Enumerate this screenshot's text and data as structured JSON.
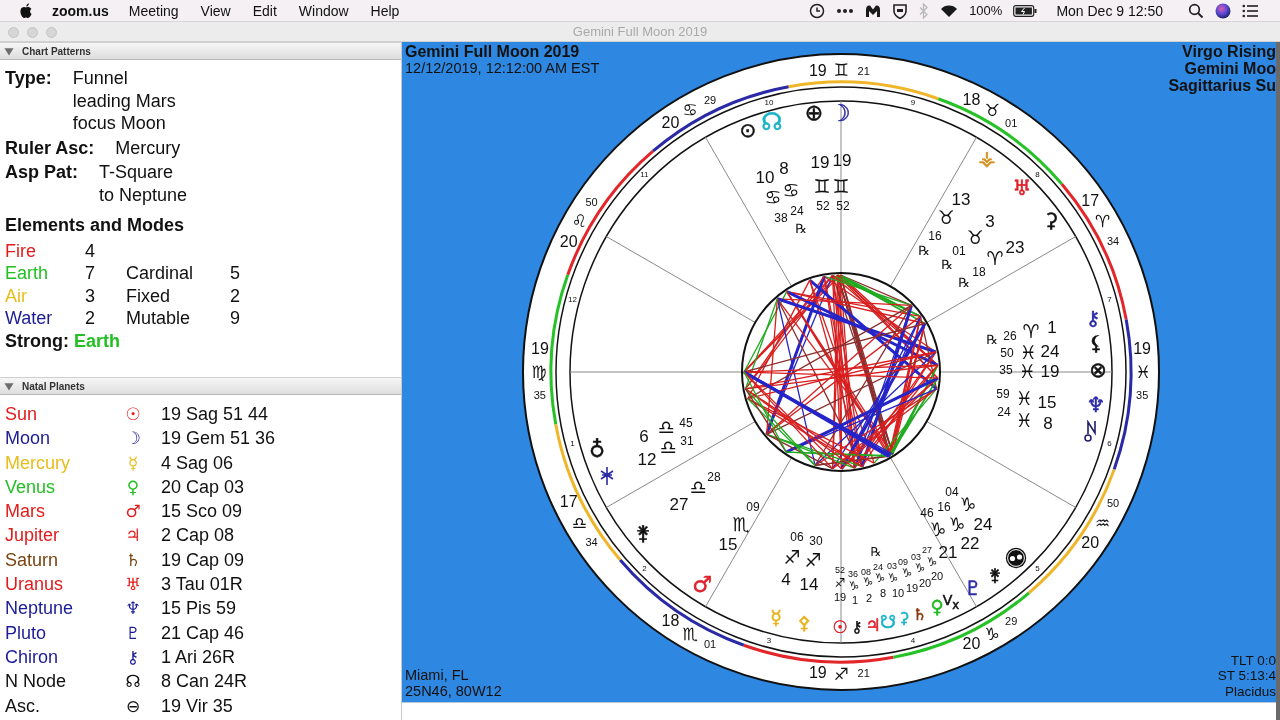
{
  "menubar": {
    "app": "zoom.us",
    "menus": [
      "Meeting",
      "View",
      "Edit",
      "Window",
      "Help"
    ],
    "battery": "100%",
    "clock": "Mon Dec 9 12:50"
  },
  "window": {
    "title": "Gemini Full Moon 2019"
  },
  "chart_patterns": {
    "title": "Chart Patterns",
    "expanded": true,
    "fields": [
      {
        "label": "Type:",
        "values": [
          "Funnel",
          "leading Mars",
          "focus Moon"
        ]
      },
      {
        "label": "Ruler Asc:",
        "values": [
          "Mercury"
        ]
      },
      {
        "label": "Asp Pat:",
        "values": [
          "T-Square",
          "to Neptune"
        ]
      }
    ],
    "elements_title": "Elements and Modes",
    "elements": [
      {
        "name": "Fire",
        "count": "4",
        "color": "#e21b1b"
      },
      {
        "name": "Earth",
        "count": "7",
        "color": "#23c023"
      },
      {
        "name": "Air",
        "count": "3",
        "color": "#e8bd1a"
      },
      {
        "name": "Water",
        "count": "2",
        "color": "#1c1c96"
      }
    ],
    "modes": [
      {
        "name": "Cardinal",
        "count": "5"
      },
      {
        "name": "Fixed",
        "count": "2"
      },
      {
        "name": "Mutable",
        "count": "9"
      }
    ],
    "strong": {
      "label": "Strong:",
      "value": "Earth",
      "color": "#23c023"
    }
  },
  "natal_planets": {
    "title": "Natal Planets",
    "expanded": true,
    "rows": [
      {
        "name": "Sun",
        "glyph": "☉",
        "position": "19 Sag 51 44",
        "color": "#e21b1b"
      },
      {
        "name": "Moon",
        "glyph": "☽",
        "position": "19 Gem 51 36",
        "color": "#1c1c96"
      },
      {
        "name": "Mercury",
        "glyph": "☿",
        "position": "4 Sag 06",
        "color": "#e8bd1a"
      },
      {
        "name": "Venus",
        "glyph": "♀",
        "position": "20 Cap 03",
        "color": "#23c023"
      },
      {
        "name": "Mars",
        "glyph": "♂",
        "position": "15 Sco 09",
        "color": "#e21b1b"
      },
      {
        "name": "Jupiter",
        "glyph": "♃",
        "position": "2 Cap 08",
        "color": "#e21b1b"
      },
      {
        "name": "Saturn",
        "glyph": "♄",
        "position": "19 Cap 09",
        "color": "#7a4412"
      },
      {
        "name": "Uranus",
        "glyph": "♅",
        "position": "3 Tau 01R",
        "color": "#e21b1b"
      },
      {
        "name": "Neptune",
        "glyph": "♆",
        "position": "15 Pis 59",
        "color": "#1c1c96"
      },
      {
        "name": "Pluto",
        "glyph": "♇",
        "position": "21 Cap 46",
        "color": "#1c1c96"
      },
      {
        "name": "Chiron",
        "glyph": "⚷",
        "position": "1 Ari 26R",
        "color": "#1c1c96"
      },
      {
        "name": "N Node",
        "glyph": "☊",
        "position": "8 Can 24R",
        "color": "#111111"
      },
      {
        "name": "Asc.",
        "glyph": "⊖",
        "position": "19 Vir 35",
        "color": "#111111"
      }
    ]
  },
  "chart": {
    "title": "Gemini Full Moon 2019",
    "datetime": "12/12/2019, 12:12:00 AM EST",
    "summary": [
      "Virgo Rising",
      "Gemini Moo",
      "Sagittarius Su"
    ],
    "location": [
      "Miami, FL",
      "25N46, 80W12"
    ],
    "info": [
      "TLT 0:0",
      "ST 5:13:4",
      "Placidus"
    ],
    "cusps": [
      {
        "degree": "19",
        "sign": "♍",
        "minutes": "35"
      },
      {
        "degree": "17",
        "sign": "♎",
        "minutes": "34"
      },
      {
        "degree": "18",
        "sign": "♏",
        "minutes": "01"
      },
      {
        "degree": "19",
        "sign": "♐",
        "minutes": "21"
      },
      {
        "degree": "20",
        "sign": "♑",
        "minutes": "29"
      },
      {
        "degree": "20",
        "sign": "♒",
        "minutes": "50"
      },
      {
        "degree": "19",
        "sign": "♓",
        "minutes": "35"
      },
      {
        "degree": "17",
        "sign": "♈",
        "minutes": "34"
      },
      {
        "degree": "18",
        "sign": "♉",
        "minutes": "01"
      },
      {
        "degree": "19",
        "sign": "♊",
        "minutes": "21"
      },
      {
        "degree": "20",
        "sign": "♋",
        "minutes": "29"
      },
      {
        "degree": "20",
        "sign": "♌",
        "minutes": "50"
      }
    ],
    "house_numbers": [
      "1",
      "2",
      "3",
      "4",
      "5",
      "6",
      "7",
      "8",
      "9",
      "10",
      "11",
      "12"
    ],
    "points": [
      {
        "glyph": "⊙",
        "color": "#111111"
      },
      {
        "glyph": "☊",
        "color": "#19b3c9"
      },
      {
        "glyph": "⊕",
        "color": "#111111"
      },
      {
        "glyph": "☽",
        "color": "#2b2ba6"
      },
      {
        "glyph": "⚶",
        "color": "#d4901e"
      },
      {
        "glyph": "♅",
        "color": "#e0202a"
      },
      {
        "glyph": "⚳",
        "color": "#111111"
      },
      {
        "glyph": "⚷",
        "color": "#2b2ba6"
      },
      {
        "glyph": "⚸",
        "color": "#111111"
      },
      {
        "glyph": "⊗",
        "color": "#111111"
      },
      {
        "glyph": "♆",
        "color": "#2b2ba6"
      },
      {
        "glyph": "♁",
        "color": "#111111"
      },
      {
        "glyph": "⚵",
        "color": "#111111"
      },
      {
        "glyph": "♂",
        "color": "#e0202a"
      },
      {
        "glyph": "☿",
        "color": "#e8b21e"
      },
      {
        "glyph": "⚴",
        "color": "#e8b21e"
      },
      {
        "glyph": "☉",
        "color": "#e0202a"
      },
      {
        "glyph": "⚷",
        "color": "#111111"
      },
      {
        "glyph": "♃",
        "color": "#e0202a"
      },
      {
        "glyph": "☋",
        "color": "#19b3c9"
      },
      {
        "glyph": "⚳",
        "color": "#19b3c9"
      },
      {
        "glyph": "♄",
        "color": "#8a3a14"
      },
      {
        "glyph": "♀",
        "color": "#22b822"
      },
      {
        "glyph": "V$_{x}$",
        "color": "#111111"
      },
      {
        "glyph": "♇",
        "color": "#2b2ba6"
      },
      {
        "glyph": "⚵",
        "color": "#111111"
      }
    ],
    "readings": [
      {
        "degree": "10",
        "sign": "♋",
        "minutes": "38"
      },
      {
        "degree": "8",
        "sign": "♋",
        "minutes": "24",
        "retrograde": "℞"
      },
      {
        "degree": "19",
        "sign": "♊",
        "minutes": "52"
      },
      {
        "degree": "19",
        "sign": "♊",
        "minutes": "52"
      },
      {
        "degree": "13",
        "sign": "♉",
        "minutes": "16",
        "retrograde": "℞"
      },
      {
        "degree": "3",
        "sign": "♉",
        "minutes": "01",
        "retrograde": "℞"
      },
      {
        "degree": "23",
        "sign": "♈",
        "minutes": "18",
        "retrograde": "℞"
      },
      {
        "degree": "1",
        "sign": "♈",
        "minutes": "26",
        "retrograde": "℞"
      },
      {
        "degree": "24",
        "sign": "♓",
        "minutes": "50"
      },
      {
        "degree": "19",
        "sign": "♓",
        "minutes": "35"
      },
      {
        "degree": "15",
        "sign": "♓",
        "minutes": "59"
      },
      {
        "degree": "8",
        "sign": "♓",
        "minutes": "24"
      },
      {
        "degree": "21",
        "sign": "♑",
        "minutes": "46"
      },
      {
        "degree": "22",
        "sign": "♑",
        "minutes": "16"
      },
      {
        "degree": "24",
        "sign": "♑",
        "minutes": "04"
      },
      {
        "degree": "19",
        "sign": "♐",
        "minutes": "52"
      },
      {
        "degree": "1",
        "sign": "♑",
        "minutes": "36"
      },
      {
        "degree": "2",
        "sign": "♑",
        "minutes": "08"
      },
      {
        "degree": "8",
        "sign": "♑",
        "minutes": "24",
        "retrograde": "℞"
      },
      {
        "degree": "10",
        "sign": "♑",
        "minutes": "03"
      },
      {
        "degree": "19",
        "sign": "♑",
        "minutes": "09"
      },
      {
        "degree": "20",
        "sign": "♑",
        "minutes": "03"
      },
      {
        "degree": "20",
        "sign": "♑",
        "minutes": "27"
      },
      {
        "degree": "6",
        "sign": "♎",
        "minutes": "45"
      },
      {
        "degree": "12",
        "sign": "♎",
        "minutes": "31"
      },
      {
        "degree": "27",
        "sign": "♎",
        "minutes": "28"
      },
      {
        "degree": "15",
        "sign": "♏",
        "minutes": "09"
      },
      {
        "degree": "4",
        "sign": "♐",
        "minutes": "06"
      },
      {
        "degree": "14",
        "sign": "♐",
        "minutes": "30"
      }
    ]
  }
}
